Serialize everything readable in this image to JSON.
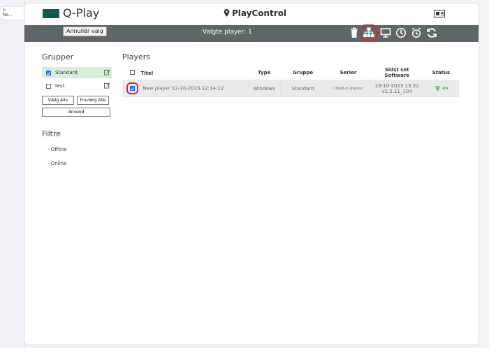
{
  "left_panel": {
    "text_top": "n",
    "text_bottom": "No..."
  },
  "app": {
    "logo": "Q-Play",
    "title": "PlayControl"
  },
  "toolbar": {
    "deselect_label": "Annullér valg",
    "selected_text": "Valgte player: 1",
    "icons": [
      "trash-icon",
      "network-icon",
      "monitor-icon",
      "clock-icon",
      "alarm-clock-icon",
      "refresh-icon"
    ],
    "highlighted_icon": "network-icon",
    "highlight_color": "#d62b2b"
  },
  "sidebar": {
    "groups_title": "Grupper",
    "groups": [
      {
        "name": "Standard",
        "checked": true
      },
      {
        "name": "test",
        "checked": false
      }
    ],
    "select_all": "Vælg Alle",
    "deselect_all": "Fravælg Alle",
    "apply": "Anvend",
    "filters_title": "Filtre",
    "filters": [
      "- Offline",
      "- Online"
    ]
  },
  "players": {
    "title": "Players",
    "columns": [
      "Titel",
      "Type",
      "Gruppe",
      "Serier",
      "Sidst set",
      "Software",
      "Status"
    ],
    "rows": [
      {
        "title": "New player 12-10-2023 12:14:12",
        "type": "Windows",
        "group": "Standard",
        "series": "Check-in stander",
        "last_seen": "13-10-2023 13:22",
        "software": "v1.2.11_104",
        "checked": true
      }
    ]
  },
  "colors": {
    "accent": "#0f5b53",
    "toolbar_bg": "#5f6668",
    "status_green": "#27a844"
  }
}
